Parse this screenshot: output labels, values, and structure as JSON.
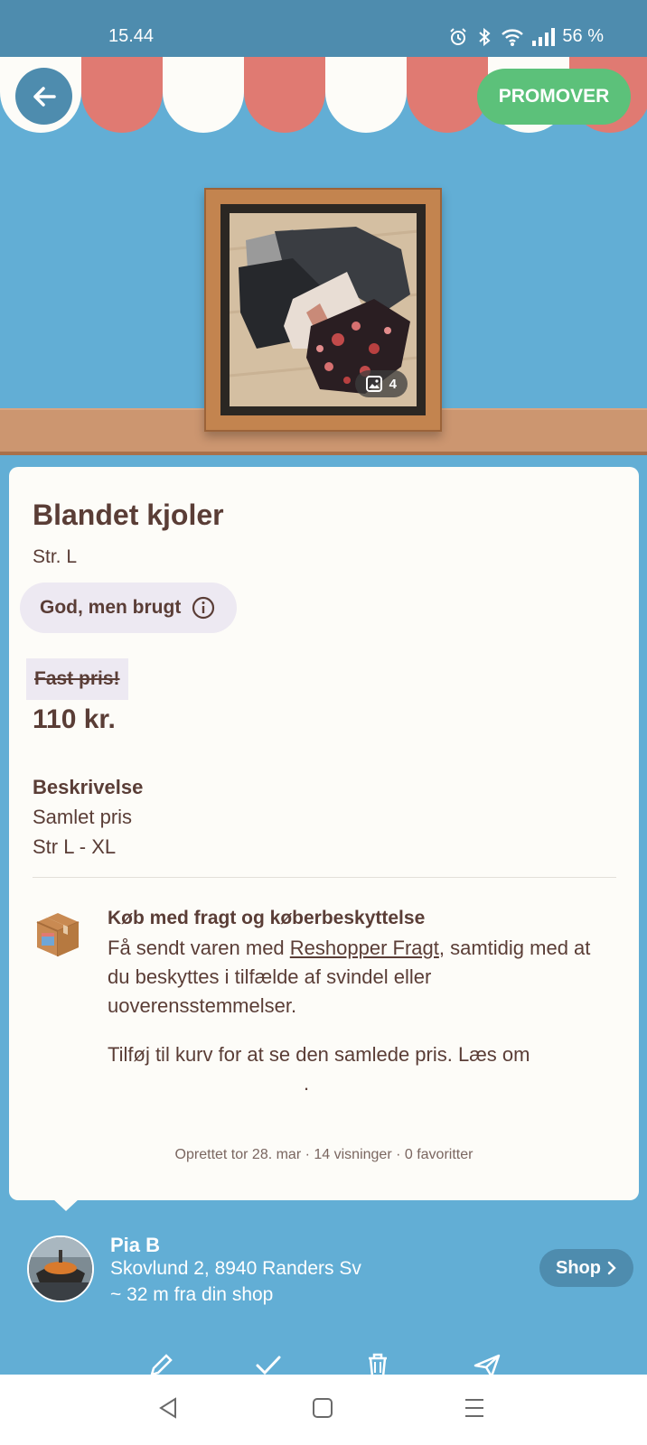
{
  "status_bar": {
    "time": "15.44",
    "battery": "56 %",
    "icons": [
      "alarm-icon",
      "bluetooth-icon",
      "wifi-icon",
      "signal-icon"
    ]
  },
  "header": {
    "back_icon": "arrow-left-icon",
    "promote_label": "PROMOVER"
  },
  "product": {
    "image_count": "4",
    "title": "Blandet kjoler",
    "size": "Str. L",
    "condition": "God, men brugt",
    "fixed_price_label": "Fast pris!",
    "price": "110 kr.",
    "description_heading": "Beskrivelse",
    "description_lines": [
      "Samlet pris",
      "Str L - XL"
    ]
  },
  "shipping": {
    "title": "Køb med fragt og køberbeskyttelse",
    "text_before": "Få sendt varen med ",
    "link": "Reshopper Fragt",
    "text_after": ", samtidig med at du beskyttes i tilfælde af svindel eller uoverensstemmelser.",
    "cart_text": "Tilføj til kurv for at se den samlede pris. Læs om",
    "cart_text_end": "."
  },
  "meta": "Oprettet tor 28. mar · 14 visninger · 0 favoritter",
  "seller": {
    "name": "Pia B",
    "address": "Skovlund 2, 8940 Randers Sv",
    "distance": "~ 32 m fra din shop",
    "shop_label": "Shop"
  },
  "actions": [
    "edit-icon",
    "check-icon",
    "trash-icon",
    "send-icon"
  ],
  "nav": [
    "back-icon",
    "home-icon",
    "menu-icon"
  ],
  "colors": {
    "background": "#62aed5",
    "status_bar": "#4e8cae",
    "promote": "#5cc17a",
    "text": "#5a3d36",
    "awning_red": "#e07a72",
    "shelf": "#cc9670"
  }
}
